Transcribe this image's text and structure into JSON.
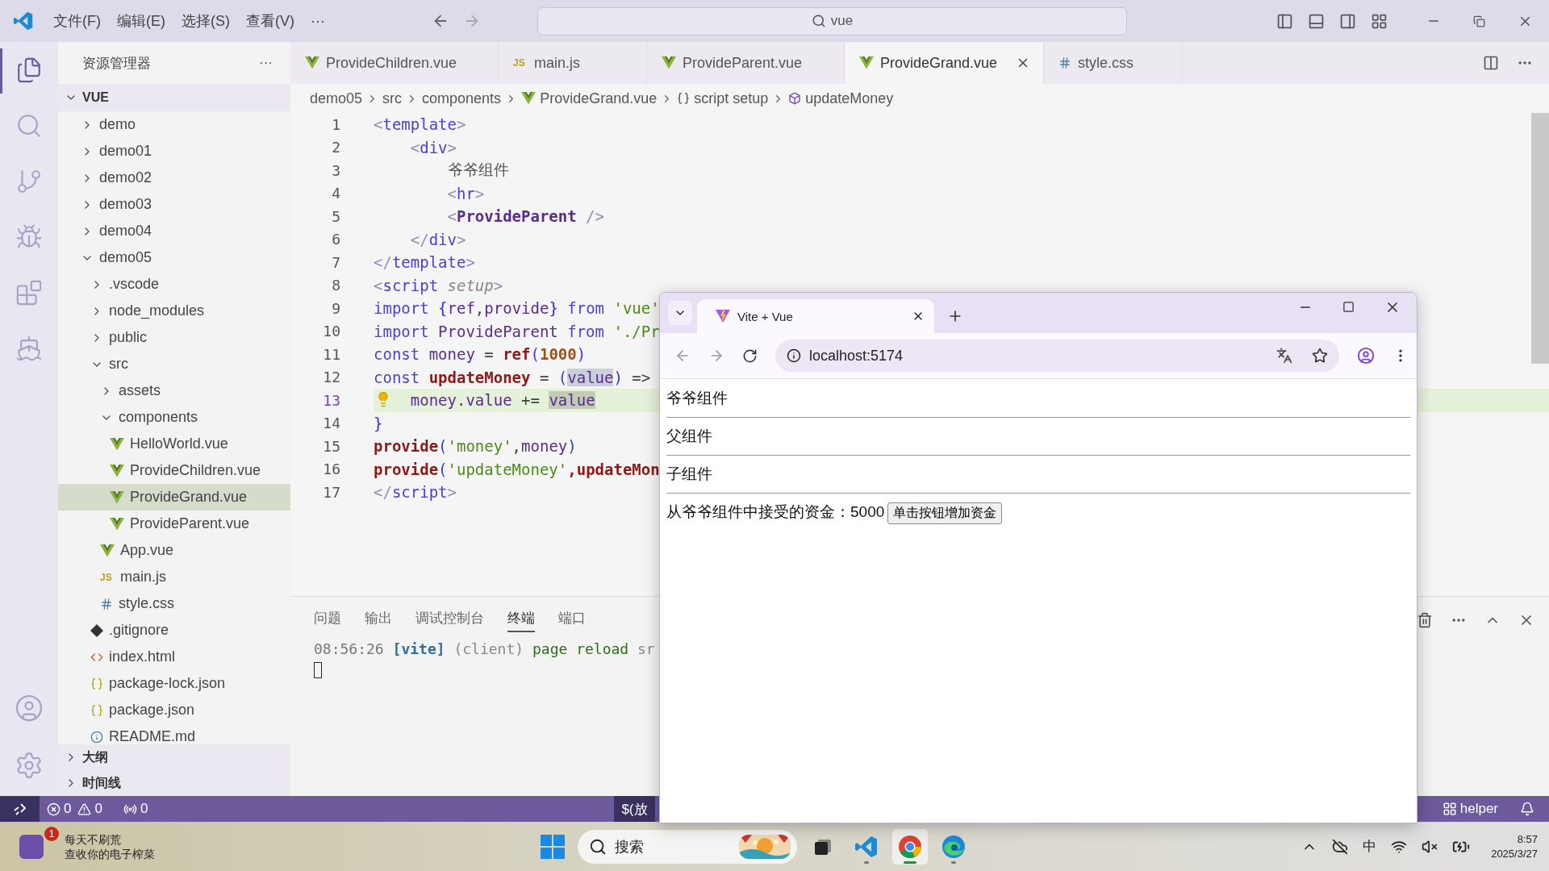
{
  "title_bar": {
    "menus": [
      "文件(F)",
      "编辑(E)",
      "选择(S)",
      "查看(V)",
      "···"
    ],
    "search": "vue"
  },
  "explorer": {
    "title": "资源管理器",
    "more": "···",
    "root": {
      "label": "VUE",
      "expanded": true
    },
    "tree": [
      {
        "name": "demo",
        "kind": "folder",
        "expanded": false,
        "selected": false
      },
      {
        "name": "demo01",
        "kind": "folder",
        "expanded": false,
        "selected": false
      },
      {
        "name": "demo02",
        "kind": "folder",
        "expanded": false,
        "selected": false
      },
      {
        "name": "demo03",
        "kind": "folder",
        "expanded": false,
        "selected": false
      },
      {
        "name": "demo04",
        "kind": "folder",
        "expanded": false,
        "selected": false
      },
      {
        "name": "demo05",
        "kind": "folder",
        "expanded": true,
        "selected": false,
        "children": [
          {
            "name": ".vscode",
            "kind": "folder",
            "expanded": false,
            "selected": false
          },
          {
            "name": "node_modules",
            "kind": "folder",
            "expanded": false,
            "selected": false
          },
          {
            "name": "public",
            "kind": "folder",
            "expanded": false,
            "selected": false
          },
          {
            "name": "src",
            "kind": "folder",
            "expanded": true,
            "selected": false,
            "children": [
              {
                "name": "assets",
                "kind": "folder",
                "expanded": false,
                "selected": false
              },
              {
                "name": "components",
                "kind": "folder",
                "expanded": true,
                "selected": false,
                "children": [
                  {
                    "name": "HelloWorld.vue",
                    "kind": "vue",
                    "selected": false
                  },
                  {
                    "name": "ProvideChildren.vue",
                    "kind": "vue",
                    "selected": false
                  },
                  {
                    "name": "ProvideGrand.vue",
                    "kind": "vue",
                    "selected": true
                  },
                  {
                    "name": "ProvideParent.vue",
                    "kind": "vue",
                    "selected": false
                  }
                ]
              },
              {
                "name": "App.vue",
                "kind": "vue",
                "selected": false
              },
              {
                "name": "main.js",
                "kind": "js",
                "icon_text": "JS",
                "selected": false
              },
              {
                "name": "style.css",
                "kind": "css",
                "selected": false
              }
            ]
          },
          {
            "name": ".gitignore",
            "kind": "git",
            "selected": false
          },
          {
            "name": "index.html",
            "kind": "html",
            "selected": false
          },
          {
            "name": "package-lock.json",
            "kind": "json",
            "selected": false
          },
          {
            "name": "package.json",
            "kind": "json",
            "selected": false
          },
          {
            "name": "README.md",
            "kind": "info",
            "selected": false
          }
        ]
      }
    ],
    "sections": [
      {
        "label": "大纲",
        "expanded": false
      },
      {
        "label": "时间线",
        "expanded": false
      }
    ]
  },
  "tabs": [
    {
      "label": "ProvideChildren.vue",
      "kind": "vue",
      "selected": false
    },
    {
      "label": "main.js",
      "kind": "js",
      "icon_text": "JS",
      "selected": false
    },
    {
      "label": "ProvideParent.vue",
      "kind": "vue",
      "selected": false
    },
    {
      "label": "ProvideGrand.vue",
      "kind": "vue",
      "selected": true
    },
    {
      "label": "style.css",
      "kind": "css",
      "selected": false
    }
  ],
  "breadcrumb": [
    {
      "label": "demo05",
      "kind": "folder"
    },
    {
      "label": "src",
      "kind": "folder"
    },
    {
      "label": "components",
      "kind": "folder"
    },
    {
      "label": "ProvideGrand.vue",
      "kind": "vue"
    },
    {
      "label": "script setup",
      "kind": "braces"
    },
    {
      "label": "updateMoney",
      "kind": "symbol"
    }
  ],
  "code": [
    {
      "number": "1",
      "current": false,
      "tokens": [
        {
          "kind": "p",
          "text": "<"
        },
        {
          "kind": "tag",
          "text": "template"
        },
        {
          "kind": "p",
          "text": ">"
        }
      ]
    },
    {
      "number": "2",
      "current": false,
      "tokens": [
        {
          "kind": "p",
          "text": "    <"
        },
        {
          "kind": "tag",
          "text": "div"
        },
        {
          "kind": "p",
          "text": ">"
        }
      ]
    },
    {
      "number": "3",
      "current": false,
      "tokens": [
        {
          "kind": "text",
          "text": "        爷爷组件"
        }
      ]
    },
    {
      "number": "4",
      "current": false,
      "tokens": [
        {
          "kind": "p",
          "text": "        <"
        },
        {
          "kind": "tag",
          "text": "hr"
        },
        {
          "kind": "p",
          "text": ">"
        }
      ]
    },
    {
      "number": "5",
      "current": false,
      "tokens": [
        {
          "kind": "p",
          "text": "        <"
        },
        {
          "kind": "comp",
          "text": "ProvideParent"
        },
        {
          "kind": "p",
          "text": " />"
        }
      ]
    },
    {
      "number": "6",
      "current": false,
      "tokens": [
        {
          "kind": "p",
          "text": "    </"
        },
        {
          "kind": "tag",
          "text": "div"
        },
        {
          "kind": "p",
          "text": ">"
        }
      ]
    },
    {
      "number": "7",
      "current": false,
      "tokens": [
        {
          "kind": "p",
          "text": "</"
        },
        {
          "kind": "tag",
          "text": "template"
        },
        {
          "kind": "p",
          "text": ">"
        }
      ]
    },
    {
      "number": "8",
      "current": false,
      "tokens": [
        {
          "kind": "p",
          "text": "<"
        },
        {
          "kind": "tag",
          "text": "script"
        },
        {
          "kind": "attr",
          "text": " setup"
        },
        {
          "kind": "p",
          "text": ">"
        }
      ]
    },
    {
      "number": "9",
      "current": false,
      "tokens": [
        {
          "kind": "kw",
          "text": "import "
        },
        {
          "kind": "brace",
          "text": "{"
        },
        {
          "kind": "var",
          "text": "ref"
        },
        {
          "kind": "op",
          "text": ","
        },
        {
          "kind": "var",
          "text": "provide"
        },
        {
          "kind": "brace",
          "text": "}"
        },
        {
          "kind": "kw",
          "text": " from "
        },
        {
          "kind": "str",
          "text": "'vue'"
        }
      ]
    },
    {
      "number": "10",
      "current": false,
      "tokens": [
        {
          "kind": "kw",
          "text": "import "
        },
        {
          "kind": "var",
          "text": "ProvideParent"
        },
        {
          "kind": "kw",
          "text": " from "
        },
        {
          "kind": "str",
          "text": "'./Pr"
        }
      ]
    },
    {
      "number": "11",
      "current": false,
      "tokens": [
        {
          "kind": "kw",
          "text": "const "
        },
        {
          "kind": "var",
          "text": "money"
        },
        {
          "kind": "op",
          "text": " = "
        },
        {
          "kind": "fn",
          "text": "ref"
        },
        {
          "kind": "paren",
          "text": "("
        },
        {
          "kind": "num",
          "text": "1000"
        },
        {
          "kind": "paren",
          "text": ")"
        }
      ]
    },
    {
      "number": "12",
      "current": false,
      "tokens": [
        {
          "kind": "kw",
          "text": "const "
        },
        {
          "kind": "fn",
          "text": "updateMoney"
        },
        {
          "kind": "op",
          "text": " = "
        },
        {
          "kind": "paren",
          "text": "("
        },
        {
          "kind": "match",
          "text": "value"
        },
        {
          "kind": "paren",
          "text": ")"
        },
        {
          "kind": "op",
          "text": " =>"
        }
      ]
    },
    {
      "number": "13",
      "current": true,
      "tokens": [
        {
          "kind": "var",
          "text": "    money"
        },
        {
          "kind": "op",
          "text": "."
        },
        {
          "kind": "var",
          "text": "value"
        },
        {
          "kind": "op",
          "text": " += "
        },
        {
          "kind": "match2",
          "text": "value"
        }
      ]
    },
    {
      "number": "14",
      "current": false,
      "tokens": [
        {
          "kind": "brace",
          "text": "}"
        }
      ]
    },
    {
      "number": "15",
      "current": false,
      "tokens": [
        {
          "kind": "fn",
          "text": "provide"
        },
        {
          "kind": "paren",
          "text": "("
        },
        {
          "kind": "str",
          "text": "'money'"
        },
        {
          "kind": "op",
          "text": ","
        },
        {
          "kind": "var",
          "text": "money"
        },
        {
          "kind": "paren",
          "text": ")"
        }
      ]
    },
    {
      "number": "16",
      "current": false,
      "tokens": [
        {
          "kind": "fn",
          "text": "provide"
        },
        {
          "kind": "paren",
          "text": "("
        },
        {
          "kind": "str",
          "text": "'updateMoney'"
        },
        {
          "kind": "fn",
          "text": ",updateMon"
        }
      ]
    },
    {
      "number": "17",
      "current": false,
      "tokens": [
        {
          "kind": "p",
          "text": "</"
        },
        {
          "kind": "tag",
          "text": "script"
        },
        {
          "kind": "p",
          "text": ">"
        }
      ]
    }
  ],
  "panel": {
    "tabs": [
      {
        "label": "问题",
        "selected": false
      },
      {
        "label": "输出",
        "selected": false
      },
      {
        "label": "调试控制台",
        "selected": false
      },
      {
        "label": "终端",
        "selected": true
      },
      {
        "label": "端口",
        "selected": false
      }
    ],
    "terminal": [
      {
        "kind": "time",
        "text": "08:56:26 "
      },
      {
        "kind": "tag",
        "text": "[vite]"
      },
      {
        "kind": "dim",
        "text": " (client)"
      },
      {
        "kind": "ok",
        "text": " page reload"
      },
      {
        "kind": "dim",
        "text": " sr"
      }
    ]
  },
  "status_bar": {
    "errors": "0",
    "warnings": "0",
    "ports": "0",
    "terminal": "$(放",
    "helper": "helper"
  },
  "browser": {
    "tab": "Vite + Vue",
    "address": "localhost:5174",
    "lines": [
      "爷爷组件",
      "父组件",
      "子组件"
    ],
    "money_text": "从爷爷组件中接受的资金：5000",
    "button": "单击按钮增加资金"
  },
  "taskbar": {
    "notification": {
      "badge": "1",
      "title": "每天不刷荒",
      "subtitle": "查收你的电子榨菜"
    },
    "search": "搜索",
    "apps": [
      {
        "kind": "taskview",
        "running": false,
        "active": false
      },
      {
        "kind": "vscode",
        "running": true,
        "active": false
      },
      {
        "kind": "chrome",
        "running": true,
        "active": true
      },
      {
        "kind": "edge",
        "running": true,
        "active": false
      }
    ],
    "ime": "中",
    "time": "8:57",
    "date": "2025/3/27"
  }
}
